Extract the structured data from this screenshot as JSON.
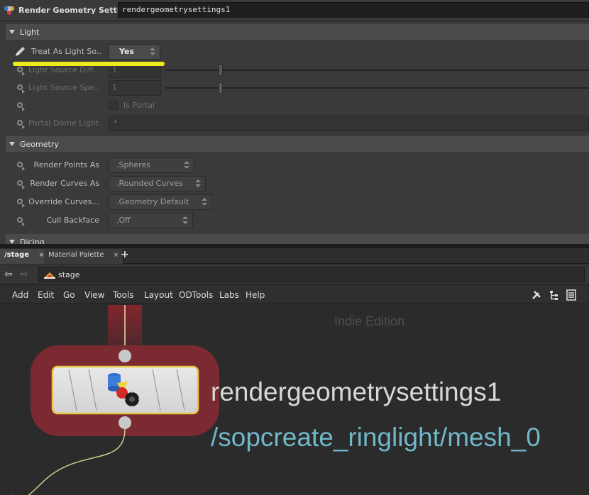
{
  "param_header": {
    "node_type": "Render Geometry Settings",
    "node_name": "rendergeometrysettings1"
  },
  "light_folder": {
    "label": "Light",
    "treat_as_light_source": {
      "label": "Treat As Light So...",
      "value": "Yes"
    },
    "light_source_diffuse": {
      "label": "Light Source Diff...",
      "value": "1"
    },
    "light_source_specular": {
      "label": "Light Source Spe...",
      "value": "1"
    },
    "is_portal": {
      "label": "Is Portal"
    },
    "portal_dome_lights": {
      "label": "Portal Dome Lights",
      "value": "*"
    }
  },
  "geometry_folder": {
    "label": "Geometry",
    "render_points_as": {
      "label": "Render Points As",
      "value": ".Spheres"
    },
    "render_curves_as": {
      "label": "Render Curves As",
      "value": ".Rounded Curves"
    },
    "override_curves": {
      "label": "Override Curves...",
      "value": ".Geometry Default"
    },
    "cull_backface": {
      "label": "Cull Backface",
      "value": ".Off"
    }
  },
  "dicing_folder": {
    "label": "Dicing"
  },
  "tabs": [
    {
      "label": "/stage",
      "close": "×"
    },
    {
      "label": "Material Palette",
      "close": "×"
    }
  ],
  "tab_add": "+",
  "path": {
    "value": "stage"
  },
  "menu": [
    "Add",
    "Edit",
    "Go",
    "View",
    "Tools",
    "Layout",
    "ODTools",
    "Labs",
    "Help"
  ],
  "network": {
    "watermark": "Indie Edition",
    "node_name": "rendergeometrysettings1",
    "node_path": "/sopcreate_ringlight/mesh_0"
  },
  "colors": {
    "highlight": "#f0e91c",
    "node_selection": "#7a2a30",
    "node_path": "#6fb7c9",
    "node_border": "#e8c646"
  },
  "icons": {
    "node_type": "render-geometry-settings-icon",
    "treat_light": "pencil-icon",
    "pin": "pin-icon",
    "back": "back-arrow-icon",
    "forward": "forward-arrow-icon",
    "path": "stage-icon",
    "tools": [
      "wrench-icon",
      "tree-icon",
      "list-icon"
    ]
  }
}
